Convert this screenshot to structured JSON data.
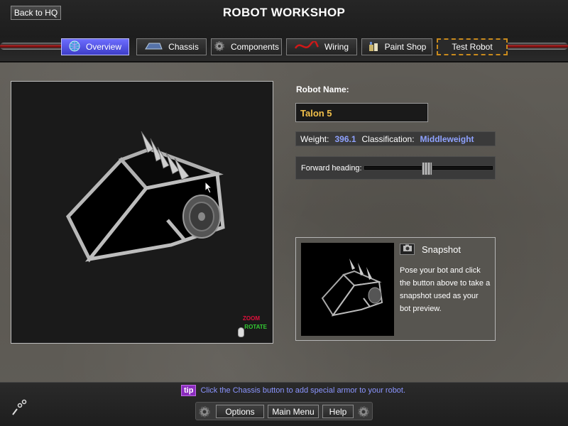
{
  "header": {
    "title": "ROBOT WORKSHOP",
    "back_label": "Back to HQ"
  },
  "tabs": [
    {
      "label": "Overview",
      "icon": "globe-icon",
      "active": true
    },
    {
      "label": "Chassis",
      "icon": "chassis-icon",
      "active": false
    },
    {
      "label": "Components",
      "icon": "gear-icon",
      "active": false
    },
    {
      "label": "Wiring",
      "icon": "wire-icon",
      "active": false
    },
    {
      "label": "Paint Shop",
      "icon": "paint-can-icon",
      "active": false
    },
    {
      "label": "Test Robot",
      "icon": "",
      "active": false
    }
  ],
  "viewport": {
    "legend_zoom": "ZOOM",
    "legend_rotate": "ROTATE"
  },
  "robot": {
    "name_label": "Robot Name:",
    "name": "Talon 5",
    "weight_label": "Weight:",
    "weight": "396.1",
    "class_label": "Classification:",
    "classification": "Middleweight",
    "heading_label": "Forward heading:",
    "heading_fraction": 0.49
  },
  "snapshot": {
    "title": "Snapshot",
    "description": "Pose your bot and click the button above to take a snapshot used as your bot preview."
  },
  "footer": {
    "tip_badge": "tip",
    "tip_text": "Click the Chassis button to add special armor to your robot.",
    "options_label": "Options",
    "main_menu_label": "Main Menu",
    "help_label": "Help"
  },
  "colors": {
    "accent_blue": "#8fa2ff",
    "name_gold": "#f2c04a",
    "tab_active": "#5050e0",
    "tip_purple": "#8b2cbf"
  }
}
